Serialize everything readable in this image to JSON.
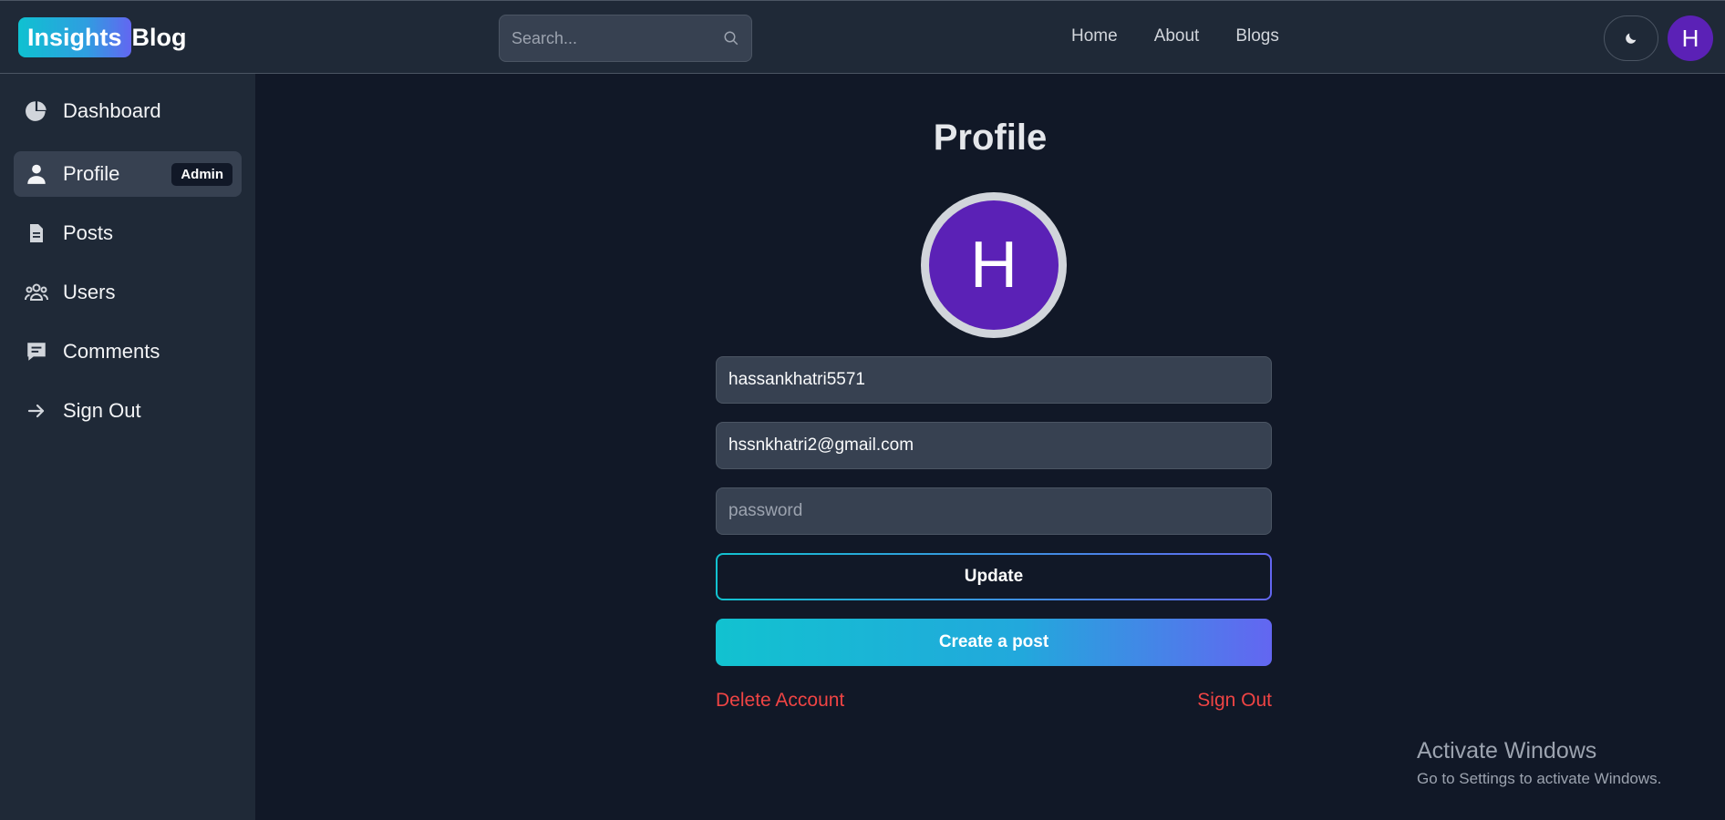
{
  "header": {
    "logo_highlight": "Insights",
    "logo_word": "Blog",
    "search_placeholder": "Search...",
    "nav": [
      "Home",
      "About",
      "Blogs"
    ],
    "avatar_initial": "H"
  },
  "sidebar": {
    "items": [
      {
        "label": "Dashboard",
        "icon": "pie-chart-icon"
      },
      {
        "label": "Profile",
        "icon": "user-icon",
        "badge": "Admin",
        "active": true
      },
      {
        "label": "Posts",
        "icon": "document-icon"
      },
      {
        "label": "Users",
        "icon": "users-icon"
      },
      {
        "label": "Comments",
        "icon": "comment-icon"
      },
      {
        "label": "Sign Out",
        "icon": "arrow-right-icon"
      }
    ]
  },
  "profile": {
    "title": "Profile",
    "avatar_initial": "H",
    "username": "hassankhatri5571",
    "email": "hssnkhatri2@gmail.com",
    "password_placeholder": "password",
    "update_label": "Update",
    "create_post_label": "Create a post",
    "delete_account_label": "Delete Account",
    "sign_out_label": "Sign Out"
  },
  "watermark": {
    "line1": "Activate Windows",
    "line2": "Go to Settings to activate Windows."
  },
  "colors": {
    "background": "#111827",
    "panel": "#1f2937",
    "input": "#374151",
    "accent_start": "#12c2d0",
    "accent_end": "#6366f1",
    "avatar": "#5b21b6",
    "danger": "#ef4444"
  }
}
